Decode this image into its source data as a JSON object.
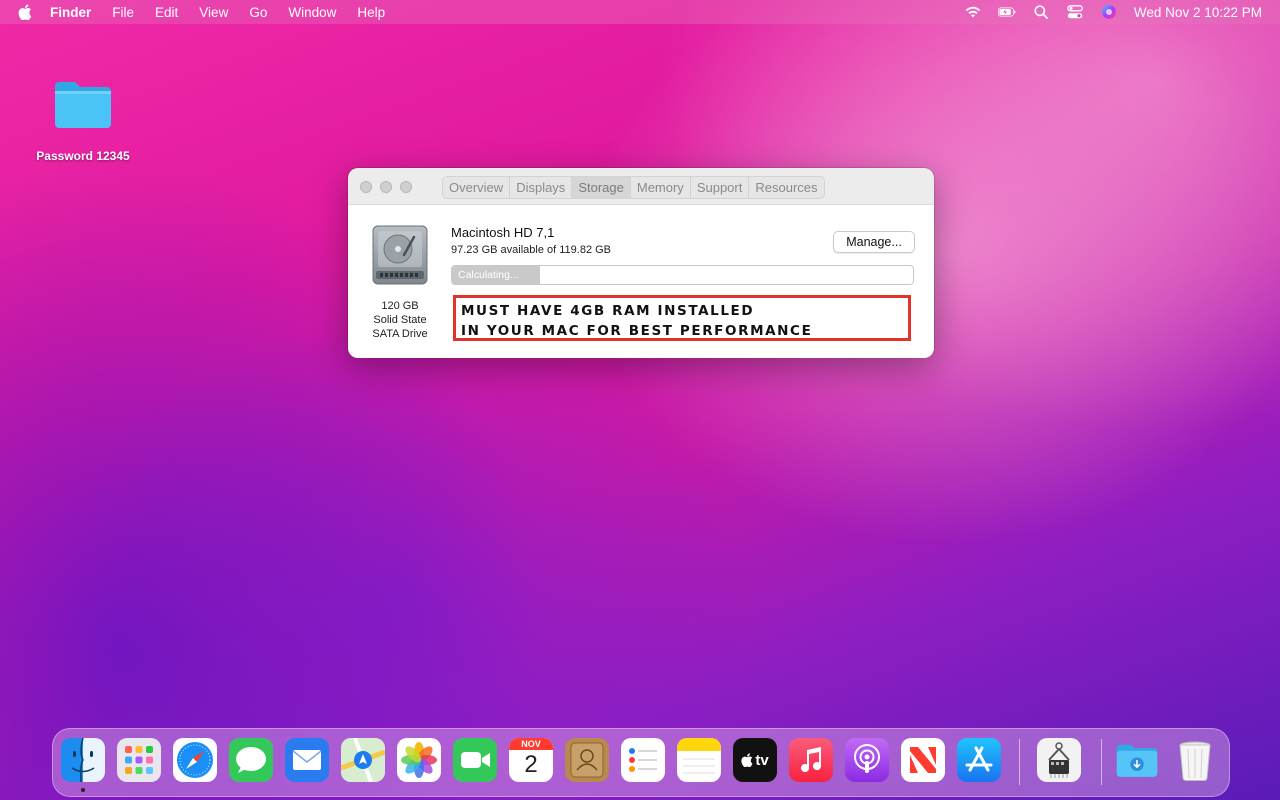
{
  "menubar": {
    "app_name": "Finder",
    "items": [
      "File",
      "Edit",
      "View",
      "Go",
      "Window",
      "Help"
    ],
    "status_icons": [
      "wifi-icon",
      "battery-icon",
      "spotlight-icon",
      "control-center-icon",
      "siri-icon"
    ],
    "clock": "Wed Nov 2  10:22 PM"
  },
  "desktop": {
    "folder_label": "Password 12345"
  },
  "window": {
    "tabs": [
      "Overview",
      "Displays",
      "Storage",
      "Memory",
      "Support",
      "Resources"
    ],
    "active_tab": "Storage",
    "drive": {
      "capacity": "120 GB",
      "type": "Solid State",
      "interface": "SATA Drive"
    },
    "volume_name": "Macintosh HD 7,1",
    "available": "97.23 GB available of 119.82 GB",
    "manage_label": "Manage...",
    "progress_label": "Calculating...",
    "progress_fraction": 0.19,
    "notice_line1": "Must have 4GB RAM installed",
    "notice_line2": "in your Mac for best performance"
  },
  "dock": {
    "apps": [
      "Finder",
      "Launchpad",
      "Safari",
      "Messages",
      "Mail",
      "Maps",
      "Photos",
      "FaceTime",
      "Calendar",
      "Contacts",
      "Reminders",
      "Notes",
      "TV",
      "Music",
      "Podcasts",
      "News",
      "App Store",
      "System Information",
      "Downloads",
      "Trash"
    ],
    "calendar_month": "NOV",
    "calendar_day": "2",
    "tv_label": "tv"
  },
  "colors": {
    "notice_border": "#e0332c",
    "accent": "#f02aa6"
  }
}
